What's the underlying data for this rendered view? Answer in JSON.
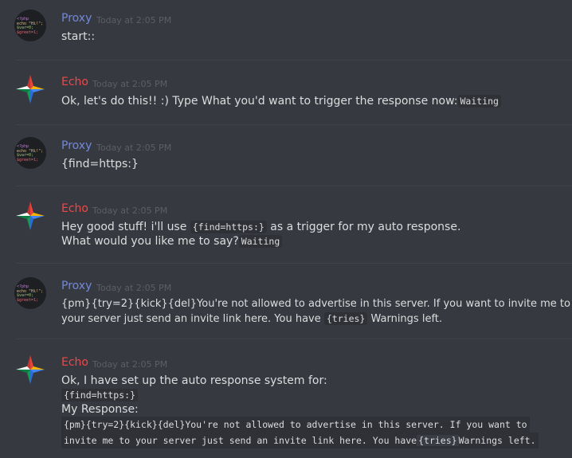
{
  "colors": {
    "proxy_name": "#7289da",
    "echo_name": "#f04747",
    "timestamp": "#5b5f66",
    "background": "#36393f"
  },
  "messages": [
    {
      "author": "Proxy",
      "timestamp": "Today at 2:05 PM",
      "avatar": "php-code-avatar",
      "text": "start::"
    },
    {
      "author": "Echo",
      "timestamp": "Today at 2:05 PM",
      "avatar": "star-avatar",
      "text": "Ok, let's do this!! :) Type What you'd want to trigger the response now:",
      "code": "Waiting"
    },
    {
      "author": "Proxy",
      "timestamp": "Today at 2:05 PM",
      "avatar": "php-code-avatar",
      "text": "{find=https:}"
    },
    {
      "author": "Echo",
      "timestamp": "Today at 2:05 PM",
      "avatar": "star-avatar",
      "line1_before": "Hey good stuff! i'll use ",
      "line1_code": "{find=https:}",
      "line1_after": " as a trigger for my auto response.",
      "line2_text": "What would you like me to say?",
      "line2_code": "Waiting"
    },
    {
      "author": "Proxy",
      "timestamp": "Today at 2:05 PM",
      "avatar": "php-code-avatar",
      "line1": "{pm}{try=2}{kick}{del}You're not allowed to advertise in this server. If you want to invite me to",
      "line2_before": "your server just send an invite link here. You have ",
      "line2_code": "{tries}",
      "line2_after": " Warnings left."
    },
    {
      "author": "Echo",
      "timestamp": "Today at 2:05 PM",
      "avatar": "star-avatar",
      "line1": "Ok, I have set up the auto response system for:",
      "line2_code": "{find=https:}",
      "line3": "My Response:",
      "line4_code": "{pm}{try=2}{kick}{del}You're not allowed to advertise in this server. If you want to",
      "line5_code_before": "invite me to your server just send an invite link here. You have",
      "line5_tries": "{tries}",
      "line5_code_after": "Warnings left."
    }
  ],
  "avatar_code": {
    "line1": "<?php",
    "line2": "echo \"Hi!\";",
    "line3": "$var=0;",
    "line4": "$greet=1;"
  }
}
